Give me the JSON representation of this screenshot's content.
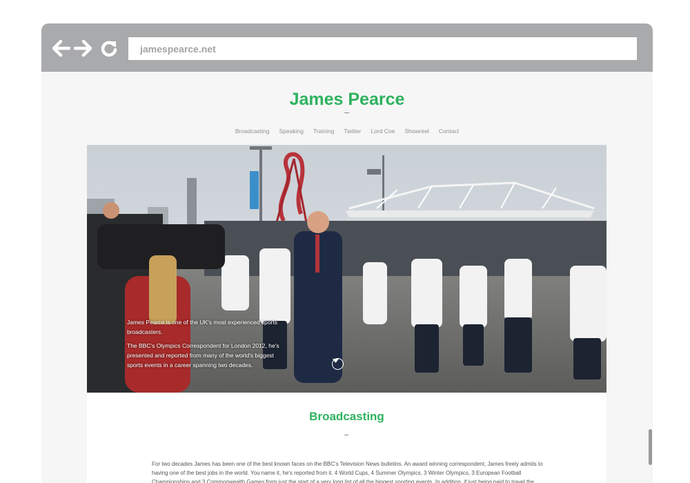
{
  "browser": {
    "url": "jamespearce.net",
    "back_icon": "arrow-left-icon",
    "forward_icon": "arrow-right-icon",
    "reload_icon": "reload-icon"
  },
  "site": {
    "title": "James Pearce",
    "nav": [
      "Broadcasting",
      "Speaking",
      "Training",
      "Twitter",
      "Lord Coe",
      "Showreel",
      "Contact"
    ]
  },
  "hero": {
    "paragraph_1": "James Pearce is one of the UK's most experienced sports broadcasters.",
    "paragraph_2": "The BBC's Olympics Correspondent for London 2012, he's presented and reported from many of the world's biggest sports events in a career spanning two decades.",
    "scroll_icon": "chevron-down-circle-icon"
  },
  "section": {
    "title": "Broadcasting",
    "body": "For two decades James has been one of the best known faces on the BBC's Television News bulletins. An award winning correspondent, James freely admits to having one of the best jobs in the world. You name it, he's reported from it. 4 World Cups, 4 Summer Olympics, 3 Winter Olympics, 3 European Football Championships and 3 Commonwealth Games form just the start of a very long list of all the biggest sporting events. In addition, if just being paid to travel the globe"
  },
  "colors": {
    "accent": "#2eb25e",
    "chrome": "#a9aaac",
    "page_bg": "#f6f6f6"
  }
}
